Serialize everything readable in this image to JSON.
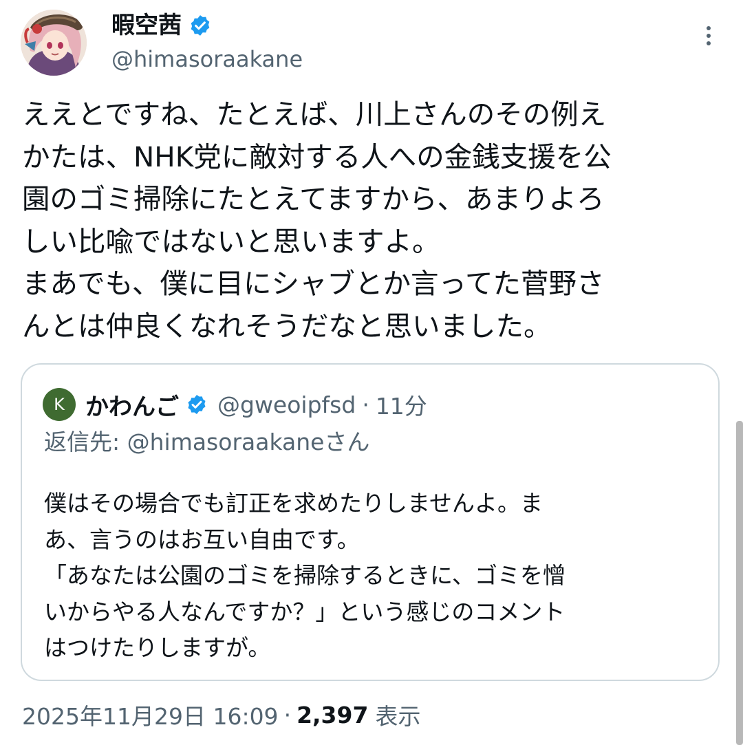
{
  "author": {
    "display_name": "暇空茜",
    "handle": "@himasoraakane",
    "verified": true
  },
  "tweet": {
    "text": "ええとですね、たとえば、川上さんのその例え\nかたは、NHK党に敵対する人への金銭支援を公\n園のゴミ掃除にたとえてますから、あまりよろ\nしい比喩ではないと思いますよ。\nまあでも、僕に目にシャブとか言ってた菅野さ\nんとは仲良くなれそうだなと思いました。"
  },
  "quote": {
    "avatar_letter": "K",
    "display_name": "かわんご",
    "handle": "@gweoipfsd",
    "separator": "·",
    "time": "11分",
    "reply_to": "返信先: @himasoraakaneさん",
    "text": "僕はその場合でも訂正を求めたりしませんよ。ま\nあ、言うのはお互い自由です。\n「あなたは公園のゴミを掃除するときに、ゴミを憎\nいからやる人なんですか？」という感じのコメント\nはつけたりしますが。"
  },
  "footer": {
    "timestamp": "2025年11月29日 16:09",
    "separator": "·",
    "views": "2,397",
    "views_label": "表示"
  },
  "colors": {
    "text": "#0f1419",
    "secondary": "#536471",
    "verified": "#1d9bf0",
    "border": "#cfd9de",
    "quote_avatar": "#3f6b31"
  },
  "icons": {
    "verified": "verified-badge-icon",
    "more": "more-vertical-icon"
  }
}
